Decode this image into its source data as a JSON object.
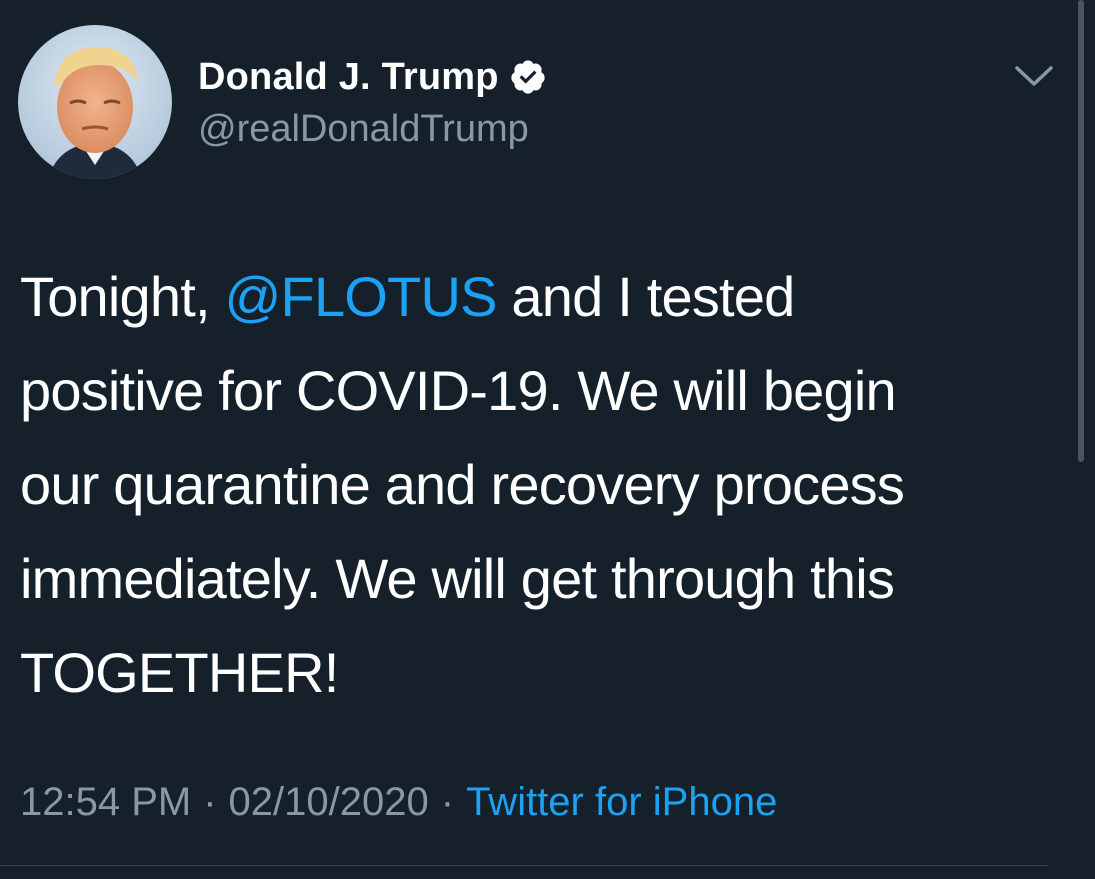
{
  "author": {
    "display_name": "Donald J. Trump",
    "handle": "@realDonaldTrump",
    "verified": true
  },
  "tweet": {
    "line1_pre": "Tonight, ",
    "line1_mention": "@FLOTUS",
    "line1_post": " and I tested",
    "line2": "positive for COVID-19. We will begin",
    "line3": "our quarantine and recovery process",
    "line4": "immediately. We will get through this",
    "line5": "TOGETHER!"
  },
  "meta": {
    "time": "12:54 PM",
    "separator": "·",
    "date": "02/10/2020",
    "source": "Twitter for iPhone"
  },
  "icons": {
    "verified": "verified-badge-icon",
    "menu": "chevron-down-icon"
  },
  "colors": {
    "background": "#15202b",
    "accent": "#1da1f2",
    "secondary_text": "#8899a6"
  }
}
